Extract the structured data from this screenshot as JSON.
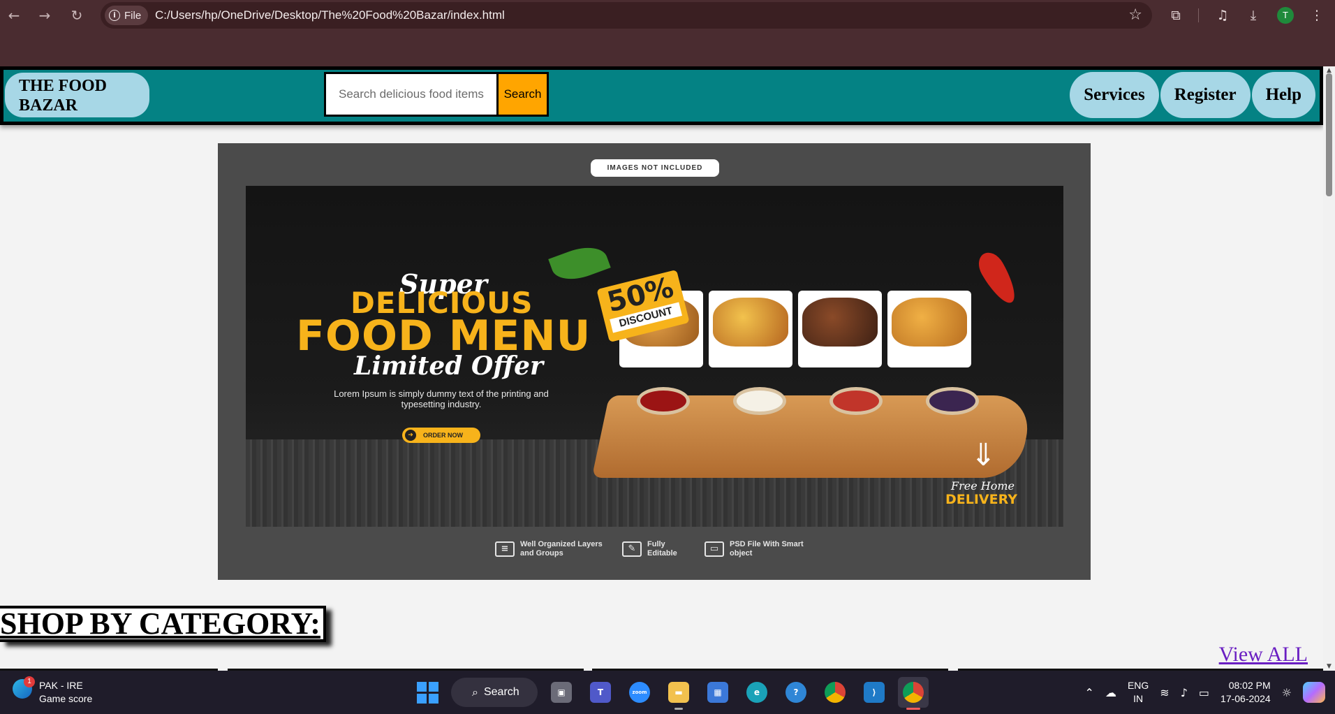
{
  "browser": {
    "site_chip": "File",
    "url": "C:/Users/hp/OneDrive/Desktop/The%20Food%20Bazar/index.html",
    "profile_initial": "T",
    "icons": [
      "back-arrow-icon",
      "forward-arrow-icon",
      "reload-icon",
      "info-icon",
      "bookmark-star-icon",
      "extensions-icon",
      "media-controls-icon",
      "download-icon",
      "more-menu-icon"
    ]
  },
  "site": {
    "logo_line1": "THE FOOD",
    "logo_line2": "BAZAR",
    "search_placeholder": "Search delicious food items",
    "search_button": "Search",
    "nav": [
      "Services",
      "Register",
      "Help"
    ],
    "colors": {
      "header": "#048284",
      "pill": "#a7d7e6",
      "search_button": "#ffa500"
    }
  },
  "banner": {
    "tag": "IMAGES NOT INCLUDED",
    "super": "Super",
    "delicious": "DELICIOUS",
    "food_menu": "FOOD MENU",
    "limited_offer": "Limited Offer",
    "lorem": "Lorem Ipsum is simply dummy text of the printing and typesetting industry.",
    "order_now": "ORDER NOW",
    "discount_pct": "50%",
    "discount_word": "DISCOUNT",
    "free_home": "Free Home",
    "delivery": "DELIVERY",
    "features": [
      {
        "icon": "layers-icon",
        "text": "Well Organized Layers and Groups"
      },
      {
        "icon": "edit-icon",
        "text": "Fully Editable"
      },
      {
        "icon": "folder-icon",
        "text": "PSD File With Smart object"
      }
    ]
  },
  "category": {
    "title": "SHOP BY CATEGORY:",
    "view_all": "View ALL"
  },
  "taskbar": {
    "weather_badge": "1",
    "weather_title": "PAK - IRE",
    "weather_sub": "Game score",
    "search_label": "Search",
    "apps": [
      "task-view",
      "teams",
      "zoom",
      "file-explorer",
      "microsoft-store",
      "edge",
      "get-help",
      "chrome",
      "vscode",
      "chrome-active"
    ],
    "lang_top": "ENG",
    "lang_bottom": "IN",
    "time": "08:02 PM",
    "date": "17-06-2024"
  }
}
